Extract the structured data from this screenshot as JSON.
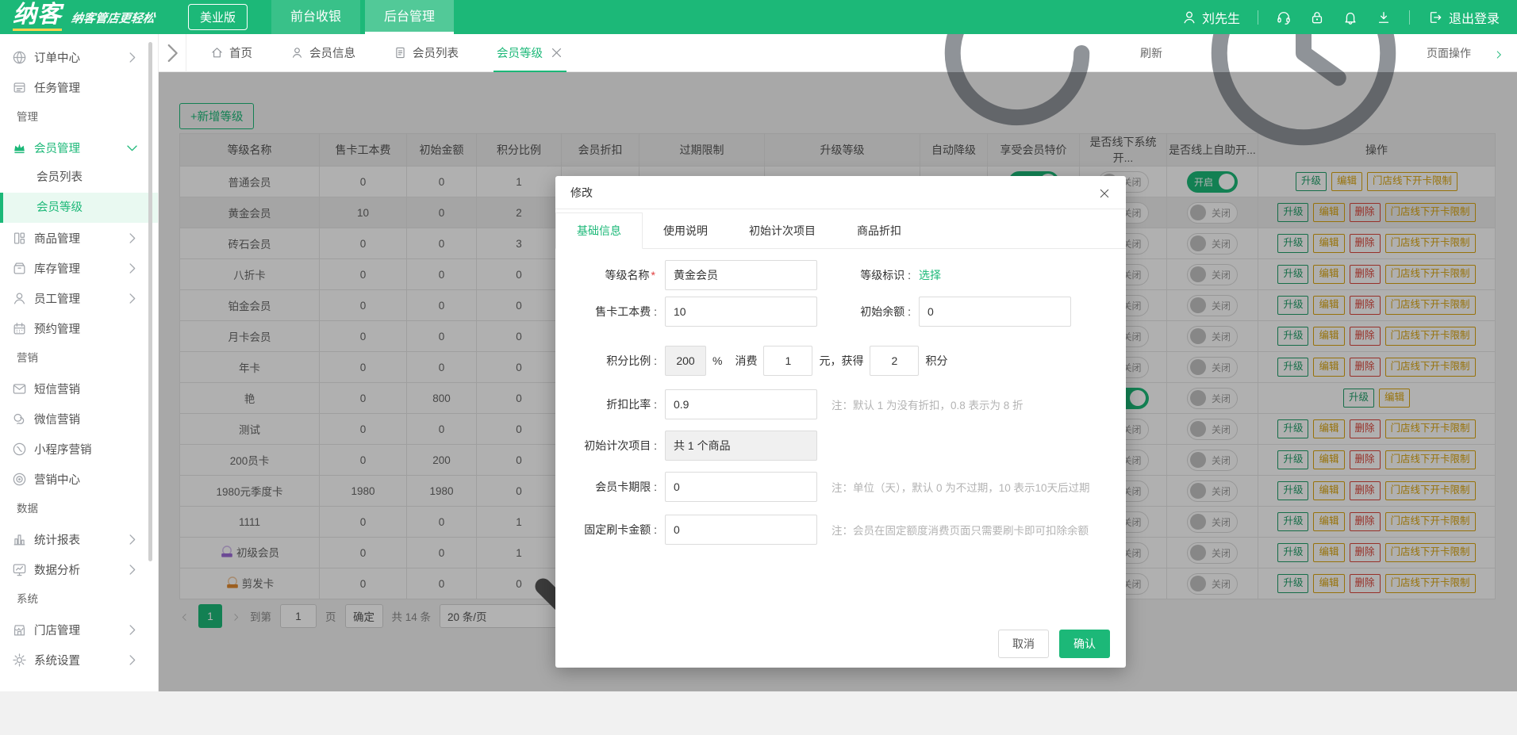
{
  "header": {
    "logo": "纳客",
    "tagline": "纳客管店更轻松",
    "edition": "美业版",
    "nav": [
      {
        "label": "前台收银",
        "active": false
      },
      {
        "label": "后台管理",
        "active": true
      }
    ],
    "user": "刘先生",
    "logout": "退出登录",
    "brand_color": "#1cb878"
  },
  "tabbar": {
    "tabs": [
      {
        "label": "首页",
        "icon": "home"
      },
      {
        "label": "会员信息",
        "icon": "user"
      },
      {
        "label": "会员列表",
        "icon": "doc"
      },
      {
        "label": "会员等级",
        "icon": "",
        "active": true,
        "closable": true
      }
    ],
    "refresh": "刷新",
    "page_ops": "页面操作"
  },
  "sidebar": {
    "items": [
      {
        "type": "item",
        "label": "订单中心",
        "icon": "globe",
        "chevron": "right"
      },
      {
        "type": "item",
        "label": "任务管理",
        "icon": "tasks"
      },
      {
        "type": "section",
        "label": "管理"
      },
      {
        "type": "item",
        "label": "会员管理",
        "icon": "crown",
        "chevron": "down",
        "green": true
      },
      {
        "type": "sub",
        "label": "会员列表"
      },
      {
        "type": "sub",
        "label": "会员等级",
        "active": true
      },
      {
        "type": "item",
        "label": "商品管理",
        "icon": "goods",
        "chevron": "right"
      },
      {
        "type": "item",
        "label": "库存管理",
        "icon": "inventory",
        "chevron": "right"
      },
      {
        "type": "item",
        "label": "员工管理",
        "icon": "staff",
        "chevron": "right"
      },
      {
        "type": "item",
        "label": "预约管理",
        "icon": "calendar"
      },
      {
        "type": "section",
        "label": "营销"
      },
      {
        "type": "item",
        "label": "短信营销",
        "icon": "sms"
      },
      {
        "type": "item",
        "label": "微信营销",
        "icon": "wechat"
      },
      {
        "type": "item",
        "label": "小程序营销",
        "icon": "miniapp"
      },
      {
        "type": "item",
        "label": "营销中心",
        "icon": "target"
      },
      {
        "type": "section",
        "label": "数据"
      },
      {
        "type": "item",
        "label": "统计报表",
        "icon": "chart",
        "chevron": "right"
      },
      {
        "type": "item",
        "label": "数据分析",
        "icon": "monitor",
        "chevron": "right"
      },
      {
        "type": "section",
        "label": "系统"
      },
      {
        "type": "item",
        "label": "门店管理",
        "icon": "store",
        "chevron": "right"
      },
      {
        "type": "item",
        "label": "系统设置",
        "icon": "gear",
        "chevron": "right"
      }
    ]
  },
  "toolbar": {
    "add_level": "+新增等级"
  },
  "table": {
    "columns": [
      "等级名称",
      "售卡工本费",
      "初始金额",
      "积分比例",
      "会员折扣",
      "过期限制",
      "升级等级",
      "自动降级",
      "享受会员特价",
      "是否线下系统开...",
      "是否线上自助开...",
      "操作"
    ],
    "toggle_on": "开启",
    "toggle_off": "关闭",
    "op_labels": {
      "upgrade": "升级",
      "edit": "编辑",
      "delete": "删除",
      "store_limit": "门店线下开卡限制"
    },
    "rows": [
      {
        "name": "普通会员",
        "fee": "0",
        "initial": "0",
        "ratio": "1",
        "special": "on",
        "offline": "off",
        "online": "on",
        "ops": [
          "upgrade",
          "edit",
          "store_limit"
        ]
      },
      {
        "name": "黄金会员",
        "fee": "10",
        "initial": "0",
        "ratio": "2",
        "offline": "off",
        "online": "off",
        "highlight": true,
        "ops": [
          "upgrade",
          "edit",
          "delete",
          "store_limit"
        ]
      },
      {
        "name": "砖石会员",
        "fee": "0",
        "initial": "0",
        "ratio": "3",
        "offline": "off",
        "online": "off",
        "ops": [
          "upgrade",
          "edit",
          "delete",
          "store_limit"
        ]
      },
      {
        "name": "八折卡",
        "fee": "0",
        "initial": "0",
        "ratio": "0",
        "offline": "off",
        "online": "off",
        "ops": [
          "upgrade",
          "edit",
          "delete",
          "store_limit"
        ]
      },
      {
        "name": "铂金会员",
        "fee": "0",
        "initial": "0",
        "ratio": "0",
        "offline": "off",
        "online": "off",
        "ops": [
          "upgrade",
          "edit",
          "delete",
          "store_limit"
        ]
      },
      {
        "name": "月卡会员",
        "fee": "0",
        "initial": "0",
        "ratio": "0",
        "offline": "off",
        "online": "off",
        "ops": [
          "upgrade",
          "edit",
          "delete",
          "store_limit"
        ]
      },
      {
        "name": "年卡",
        "fee": "0",
        "initial": "0",
        "ratio": "0",
        "offline": "off",
        "online": "off",
        "ops": [
          "upgrade",
          "edit",
          "delete",
          "store_limit"
        ]
      },
      {
        "name": "艳",
        "fee": "0",
        "initial": "800",
        "ratio": "0",
        "offline": "on",
        "online": "off",
        "ops": [
          "upgrade",
          "edit"
        ]
      },
      {
        "name": "测试",
        "fee": "0",
        "initial": "0",
        "ratio": "0",
        "offline": "off",
        "online": "off",
        "ops": [
          "upgrade",
          "edit",
          "delete",
          "store_limit"
        ]
      },
      {
        "name": "200员卡",
        "fee": "0",
        "initial": "200",
        "ratio": "0",
        "offline": "off",
        "online": "off",
        "ops": [
          "upgrade",
          "edit",
          "delete",
          "store_limit"
        ]
      },
      {
        "name": "1980元季度卡",
        "fee": "1980",
        "initial": "1980",
        "ratio": "0",
        "offline": "off",
        "online": "off",
        "ops": [
          "upgrade",
          "edit",
          "delete",
          "store_limit"
        ]
      },
      {
        "name": "1111",
        "fee": "0",
        "initial": "0",
        "ratio": "1",
        "offline": "off",
        "online": "off",
        "ops": [
          "upgrade",
          "edit",
          "delete",
          "store_limit"
        ]
      },
      {
        "name": "初级会员",
        "fee": "0",
        "initial": "0",
        "ratio": "1",
        "badge": "#9b6bd6",
        "offline": "off",
        "online": "off",
        "ops": [
          "upgrade",
          "edit",
          "delete",
          "store_limit"
        ]
      },
      {
        "name": "剪发卡",
        "fee": "0",
        "initial": "0",
        "ratio": "0",
        "badge": "#e0882e",
        "offline": "off",
        "online": "off",
        "ops": [
          "upgrade",
          "edit",
          "delete",
          "store_limit"
        ]
      }
    ]
  },
  "pagination": {
    "current": "1",
    "goto_label": "到第",
    "page_value": "1",
    "page_unit": "页",
    "confirm": "确定",
    "total": "共 14 条",
    "page_size": "20 条/页"
  },
  "modal": {
    "title": "修改",
    "tabs": [
      {
        "label": "基础信息",
        "active": true
      },
      {
        "label": "使用说明"
      },
      {
        "label": "初始计次项目"
      },
      {
        "label": "商品折扣"
      }
    ],
    "fields": {
      "level_name": {
        "label": "等级名称",
        "required_mark": "*",
        "value": "黄金会员"
      },
      "level_badge": {
        "label": "等级标识 :",
        "link": "选择"
      },
      "card_fee": {
        "label": "售卡工本费 :",
        "value": "10"
      },
      "initial_balance": {
        "label": "初始余额 :",
        "value": "0"
      },
      "points": {
        "label": "积分比例 :",
        "rate": "200",
        "pct": "%",
        "consume_label": "消费",
        "consume": "1",
        "mid": "元，获得",
        "gain": "2",
        "unit": "积分"
      },
      "discount": {
        "label": "折扣比率 :",
        "value": "0.9",
        "note": "注：默认 1 为没有折扣，0.8 表示为 8 折"
      },
      "initial_items": {
        "label": "初始计次项目 :",
        "value": "共 1 个商品"
      },
      "card_term": {
        "label": "会员卡期限 :",
        "value": "0",
        "note": "注：单位（天），默认 0 为不过期，10 表示10天后过期"
      },
      "fixed_amount": {
        "label": "固定刷卡金额 :",
        "value": "0",
        "note": "注：会员在固定额度消费页面只需要刷卡即可扣除余额"
      }
    },
    "cancel": "取消",
    "confirm": "确认"
  }
}
